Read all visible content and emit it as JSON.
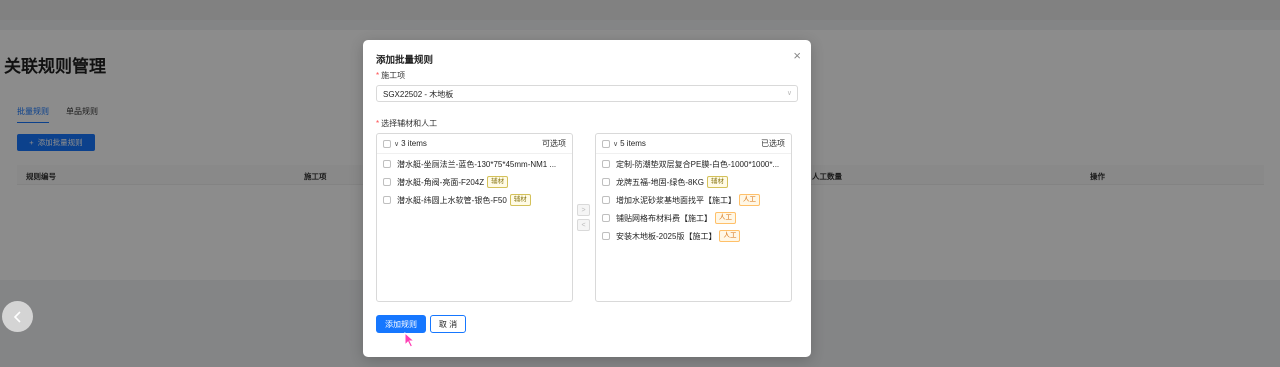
{
  "page": {
    "title": "关联规则管理",
    "tabs": [
      {
        "label": "批量规则",
        "active": true
      },
      {
        "label": "单品规则",
        "active": false
      }
    ],
    "add_button": "添加批量规则",
    "table_headers": [
      "规则编号",
      "施工项",
      "人工数量",
      "操作"
    ]
  },
  "modal": {
    "title": "添加批量规则",
    "construction_label": "施工项",
    "construction_value": "SGX22502 - 木地板",
    "materials_label": "选择辅材和人工",
    "left_list": {
      "count": "3 items",
      "title": "可选项",
      "items": [
        {
          "text": "潜水艇-坐厕法兰-蓝色-130*75*45mm-NM1 ...",
          "tag": ""
        },
        {
          "text": "潜水艇-角阀-亮面-F204Z",
          "tag": "辅材"
        },
        {
          "text": "潜水艇-纬圆上水软管-银色-F50",
          "tag": "辅材"
        }
      ]
    },
    "right_list": {
      "count": "5 items",
      "title": "已选项",
      "items": [
        {
          "text": "定制-防潮垫双层复合PE膜-白色-1000*1000*...",
          "tag": ""
        },
        {
          "text": "龙牌五福-地固-绿色-8KG",
          "tag": "辅材"
        },
        {
          "text": "增加水泥砂浆基地面找平【施工】",
          "tag": "人工"
        },
        {
          "text": "铺贴网格布材料费【施工】",
          "tag": "人工"
        },
        {
          "text": "安装木地板-2025版【施工】",
          "tag": "人工"
        }
      ]
    },
    "move_right": ">",
    "move_left": "<",
    "submit_button": "添加规则",
    "cancel_button": "取 消",
    "close": "×"
  },
  "colors": {
    "primary": "#1677ff",
    "overlay": "rgba(0,0,0,0.45)"
  }
}
